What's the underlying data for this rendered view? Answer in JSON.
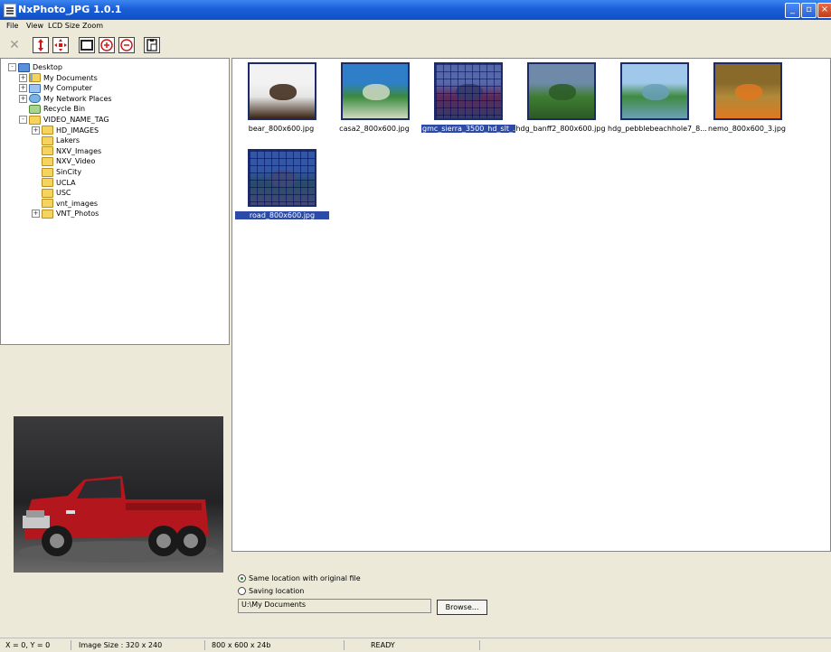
{
  "window": {
    "title": "NxPhoto_JPG 1.0.1"
  },
  "menu": [
    "File",
    "View",
    "LCD Size",
    "Zoom"
  ],
  "toolbar": {
    "buttons": [
      "close-icon",
      "fit-height-icon",
      "fit-all-icon",
      "window-icon",
      "zoom-in-icon",
      "zoom-out-icon",
      "paste-icon"
    ]
  },
  "tree": {
    "nodes": [
      {
        "label": "Desktop",
        "level": 0,
        "expander": "-",
        "icon": "desktop-icon"
      },
      {
        "label": "My Documents",
        "level": 1,
        "expander": "+",
        "icon": "folder-documents-icon"
      },
      {
        "label": "My Computer",
        "level": 1,
        "expander": "+",
        "icon": "computer-icon"
      },
      {
        "label": "My Network Places",
        "level": 1,
        "expander": "+",
        "icon": "network-icon"
      },
      {
        "label": "Recycle Bin",
        "level": 1,
        "expander": "",
        "icon": "recycle-bin-icon"
      },
      {
        "label": "VIDEO_NAME_TAG",
        "level": 1,
        "expander": "-",
        "icon": "folder-icon"
      },
      {
        "label": "HD_IMAGES",
        "level": 2,
        "expander": "+",
        "icon": "folder-icon"
      },
      {
        "label": "Lakers",
        "level": 2,
        "expander": "",
        "icon": "folder-icon"
      },
      {
        "label": "NXV_Images",
        "level": 2,
        "expander": "",
        "icon": "folder-icon"
      },
      {
        "label": "NXV_Video",
        "level": 2,
        "expander": "",
        "icon": "folder-icon"
      },
      {
        "label": "SinCity",
        "level": 2,
        "expander": "",
        "icon": "folder-icon"
      },
      {
        "label": "UCLA",
        "level": 2,
        "expander": "",
        "icon": "folder-icon"
      },
      {
        "label": "USC",
        "level": 2,
        "expander": "",
        "icon": "folder-icon"
      },
      {
        "label": "vnt_images",
        "level": 2,
        "expander": "",
        "icon": "folder-icon"
      },
      {
        "label": "VNT_Photos",
        "level": 2,
        "expander": "+",
        "icon": "folder-icon"
      }
    ]
  },
  "thumbnails": [
    {
      "label": "bear_800x600.jpg",
      "selected": false,
      "colors": [
        "#f2f2f2",
        "#e6e6e6",
        "#3a2414"
      ]
    },
    {
      "label": "casa2_800x600.jpg",
      "selected": false,
      "colors": [
        "#2e7fc8",
        "#3a8a3f",
        "#cfd9c0"
      ]
    },
    {
      "label": "gmc_sierra_3500_hd_slt_...",
      "selected": true,
      "colors": [
        "#7a8db0",
        "#8d1a1a",
        "#3c3c3c"
      ]
    },
    {
      "label": "hdg_banff2_800x600.jpg",
      "selected": false,
      "colors": [
        "#6e8aa8",
        "#3f7d33",
        "#2c5a24"
      ]
    },
    {
      "label": "hdg_pebblebeachhole7_8...",
      "selected": false,
      "colors": [
        "#9fc8ea",
        "#3f8a41",
        "#6aa0b8"
      ]
    },
    {
      "label": "nemo_800x600_3.jpg",
      "selected": false,
      "colors": [
        "#8a6a2a",
        "#b08a3a",
        "#e07820"
      ]
    },
    {
      "label": "road_800x600.jpg",
      "selected": true,
      "colors": [
        "#3b6ea8",
        "#2a5a3a",
        "#555555"
      ]
    }
  ],
  "save": {
    "option_same": "Same location with original file",
    "option_saving": "Saving location",
    "selected": "same",
    "path": "U:\\My Documents",
    "browse_label": "Browse..."
  },
  "status": {
    "coords": "X = 0, Y = 0",
    "image_size": "Image Size : 320 x 240",
    "dimensions": "800  x  600  x  24b",
    "state": "READY"
  },
  "colors": {
    "title_blue": "#1a5fd8",
    "selection": "#2c4aa8",
    "truck_red": "#b3161c"
  }
}
